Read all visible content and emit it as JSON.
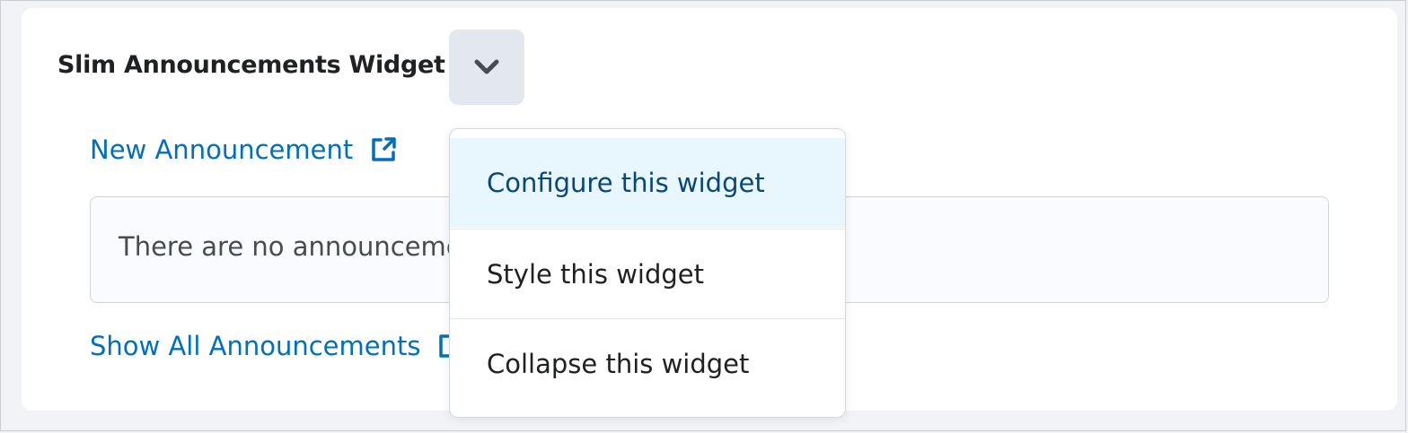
{
  "widget": {
    "title": "Slim Announcements Widget",
    "menu_button_icon": "chevron-down-icon",
    "new_announcement_label": "New Announcement",
    "empty_message": "There are no announcements to display.",
    "show_all_label": "Show All Announcements",
    "external_link_icon": "external-link-icon"
  },
  "dropdown": {
    "items": [
      {
        "label": "Configure this widget",
        "highlighted": true
      },
      {
        "label": "Style this widget",
        "highlighted": false
      },
      {
        "label": "Collapse this widget",
        "highlighted": false
      }
    ]
  },
  "colors": {
    "link": "#006fbf",
    "highlight_bg": "#e8f6fd",
    "highlight_text": "#0b4679",
    "button_bg": "#e3e8ef"
  }
}
